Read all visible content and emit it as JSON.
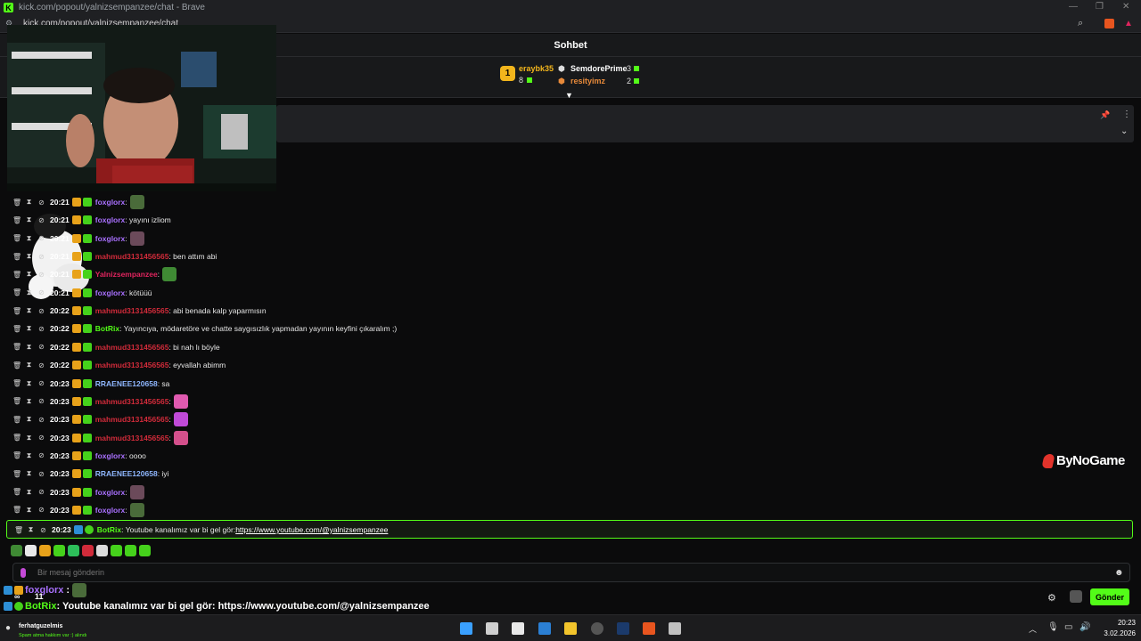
{
  "browser": {
    "title": "kick.com/popout/yalnizsempanzee/chat - Brave",
    "url": "kick.com/popout/yalnizsempanzee/chat"
  },
  "chat": {
    "header_title": "Sohbet",
    "leaderboard": {
      "first": {
        "rank": "1",
        "name": "eraybk35",
        "count": "8"
      },
      "second": {
        "name": "SemdorePrime",
        "count": "3"
      },
      "third": {
        "name": "resityimz",
        "count": "2"
      }
    },
    "watermark": "ByNoGame",
    "messages": [
      {
        "time": "20:21",
        "user": "foxglorx",
        "color": "#a970ff",
        "text": ":",
        "emote": "#4a6b3a"
      },
      {
        "time": "20:21",
        "user": "foxglorx",
        "color": "#a970ff",
        "text": ": yayını izliom",
        "emote": ""
      },
      {
        "time": "20:21",
        "user": "foxglorx",
        "color": "#a970ff",
        "text": ":",
        "emote": "#6b4a5a"
      },
      {
        "time": "20:21",
        "user": "mahmud3131456565",
        "color": "#d12b3a",
        "text": ": ben attım abi",
        "emote": ""
      },
      {
        "time": "20:21",
        "user": "Yalnizsempanzee",
        "color": "#e0245e",
        "text": ":",
        "emote": "#3f8a34"
      },
      {
        "time": "20:21",
        "user": "foxglorx",
        "color": "#a970ff",
        "text": ": kötüüü",
        "emote": ""
      },
      {
        "time": "20:22",
        "user": "mahmud3131456565",
        "color": "#d12b3a",
        "text": ": abi benada kalp yaparmısın",
        "emote": ""
      },
      {
        "time": "20:22",
        "user": "BotRix",
        "color": "#53fc18",
        "text": ": Yayıncıya, mödaretöre ve chatte saygısızlık yapmadan yayının keyfini çıkaralım ;)",
        "emote": ""
      },
      {
        "time": "20:22",
        "user": "mahmud3131456565",
        "color": "#d12b3a",
        "text": ": bi nah lı böyle",
        "emote": ""
      },
      {
        "time": "20:22",
        "user": "mahmud3131456565",
        "color": "#d12b3a",
        "text": ": eyvallah abimm",
        "emote": ""
      },
      {
        "time": "20:23",
        "user": "RRAENEE120658",
        "color": "#8fb7ff",
        "text": ": sa",
        "emote": ""
      },
      {
        "time": "20:23",
        "user": "mahmud3131456565",
        "color": "#d12b3a",
        "text": ":",
        "emote": "#e05ab0"
      },
      {
        "time": "20:23",
        "user": "mahmud3131456565",
        "color": "#d12b3a",
        "text": ":",
        "emote": "#c04ad8"
      },
      {
        "time": "20:23",
        "user": "mahmud3131456565",
        "color": "#d12b3a",
        "text": ":",
        "emote": "#d4508c"
      },
      {
        "time": "20:23",
        "user": "foxglorx",
        "color": "#a970ff",
        "text": ": oooo",
        "emote": ""
      },
      {
        "time": "20:23",
        "user": "RRAENEE120658",
        "color": "#8fb7ff",
        "text": ": iyi",
        "emote": ""
      },
      {
        "time": "20:23",
        "user": "foxglorx",
        "color": "#a970ff",
        "text": ":",
        "emote": "#6b4a5a"
      },
      {
        "time": "20:23",
        "user": "foxglorx",
        "color": "#a970ff",
        "text": ":",
        "emote": "#4a6b3a"
      }
    ],
    "highlight": {
      "time": "20:23",
      "user": "BotRix",
      "text": ": Youtube kanalımız var bi gel gör: ",
      "link": "https://www.youtube.com/@yalnizsempanzee"
    },
    "input_placeholder": "Bir mesaj gönderin",
    "send_label": "Gönder"
  },
  "overlay": {
    "line1_user": "foxglorx",
    "line1_text": ":",
    "line2_user": "BotRix",
    "line2_text": " : Youtube kanalımız var bi gel gör: https://www.youtube.com/@yalnizsempanzee",
    "counter": "11"
  },
  "taskbar": {
    "notif_user": "ferhatguzelmis",
    "notif_text": "Spam atma hakkım var :) alındı",
    "time": "20:23",
    "date": "3.02.2026"
  }
}
